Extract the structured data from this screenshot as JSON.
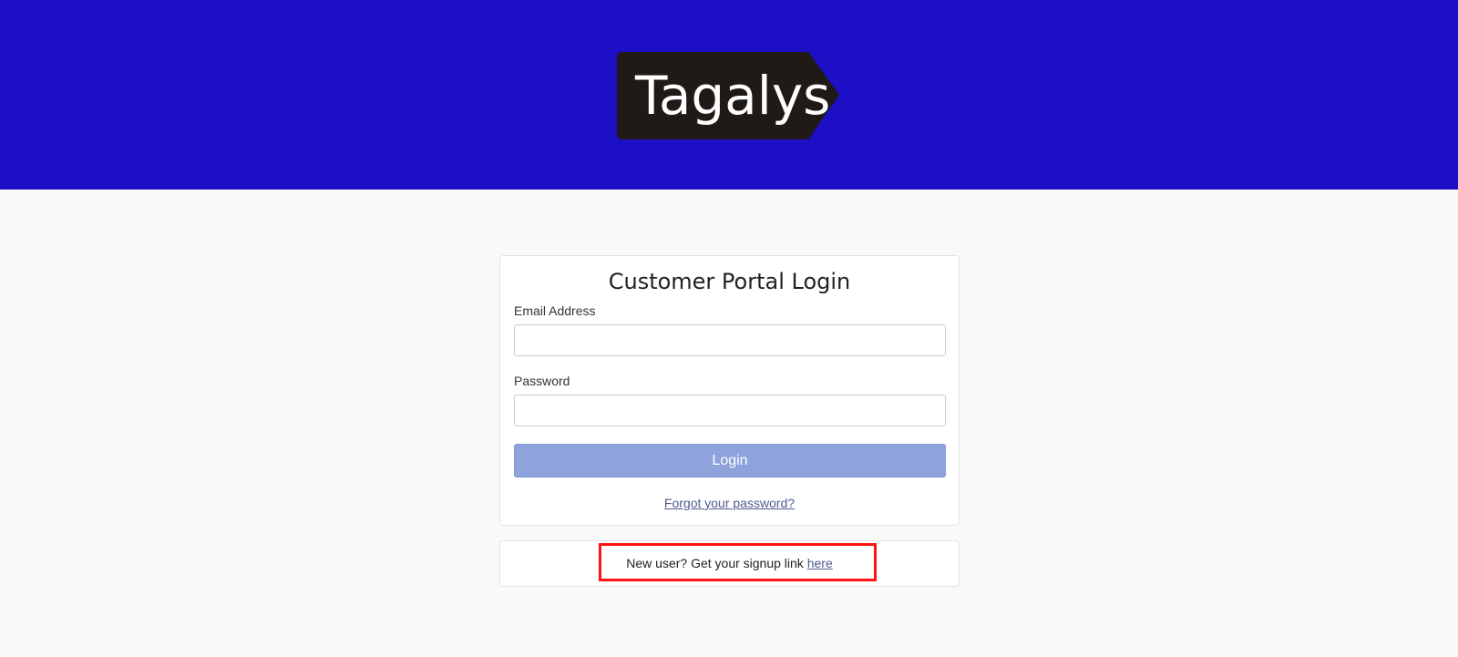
{
  "header": {
    "logo_text": "Tagalys",
    "background": "#1d0fc6"
  },
  "login": {
    "title": "Customer Portal Login",
    "email_label": "Email Address",
    "email_value": "",
    "password_label": "Password",
    "password_value": "",
    "login_button": "Login",
    "forgot_link": "Forgot your password?"
  },
  "signup": {
    "text": "New user? Get your signup link ",
    "link": "here",
    "highlight_color": "#ff1111"
  }
}
